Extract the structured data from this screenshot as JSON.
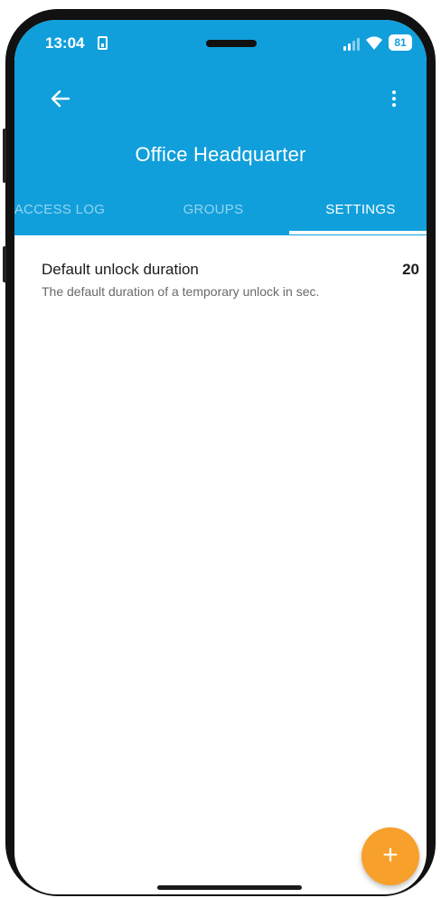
{
  "status_bar": {
    "time": "13:04",
    "battery": "81",
    "icons": [
      "sim-card-icon",
      "signal-icon",
      "wifi-icon",
      "battery-icon"
    ]
  },
  "app_bar": {
    "title": "Office Headquarter",
    "back_icon": "arrow-left-icon",
    "menu_icon": "more-vertical-icon",
    "background_color": "#109fdb"
  },
  "tabs": [
    {
      "label": "ACCESS LOG",
      "active": false
    },
    {
      "label": "GROUPS",
      "active": false
    },
    {
      "label": "SETTINGS",
      "active": true
    }
  ],
  "settings": [
    {
      "title": "Default unlock duration",
      "description": "The default duration of a temporary unlock in sec.",
      "value": "20"
    }
  ],
  "fab": {
    "icon": "plus-icon",
    "label": "+",
    "color": "#f7a02b"
  }
}
